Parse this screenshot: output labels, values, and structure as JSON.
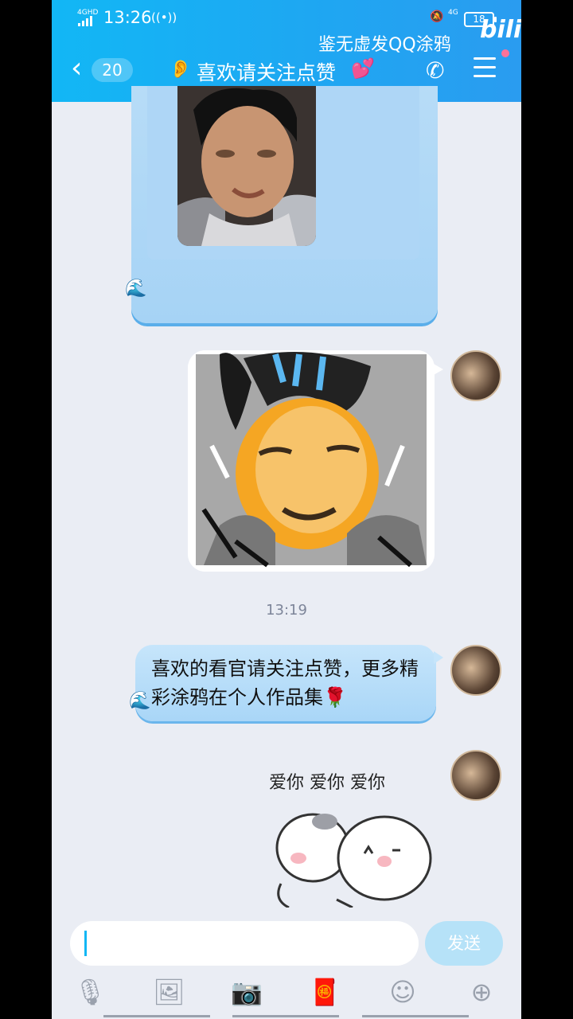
{
  "status_bar": {
    "network_left": "4GHD",
    "time": "13:26",
    "hotspot_icon": "hotspot-icon",
    "network_right": "4G",
    "battery": "18"
  },
  "watermark": {
    "text": "鉴无虚发QQ涂鸦",
    "brand": "bilibili"
  },
  "nav": {
    "unread_count": "20",
    "title": "喜欢请关注点赞",
    "title_icon": "heart-icon"
  },
  "messages": {
    "timestamp": "13:19",
    "text": "喜欢的看官请关注点赞，更多精彩涂鸦在个人作品集🌹",
    "sticker_caption": "爱你 爱你 爱你"
  },
  "input": {
    "placeholder": "",
    "send_label": "发送"
  },
  "colors": {
    "header": "#12b7f5",
    "bubble": "#b7dcf7",
    "background": "#eaedf4"
  }
}
